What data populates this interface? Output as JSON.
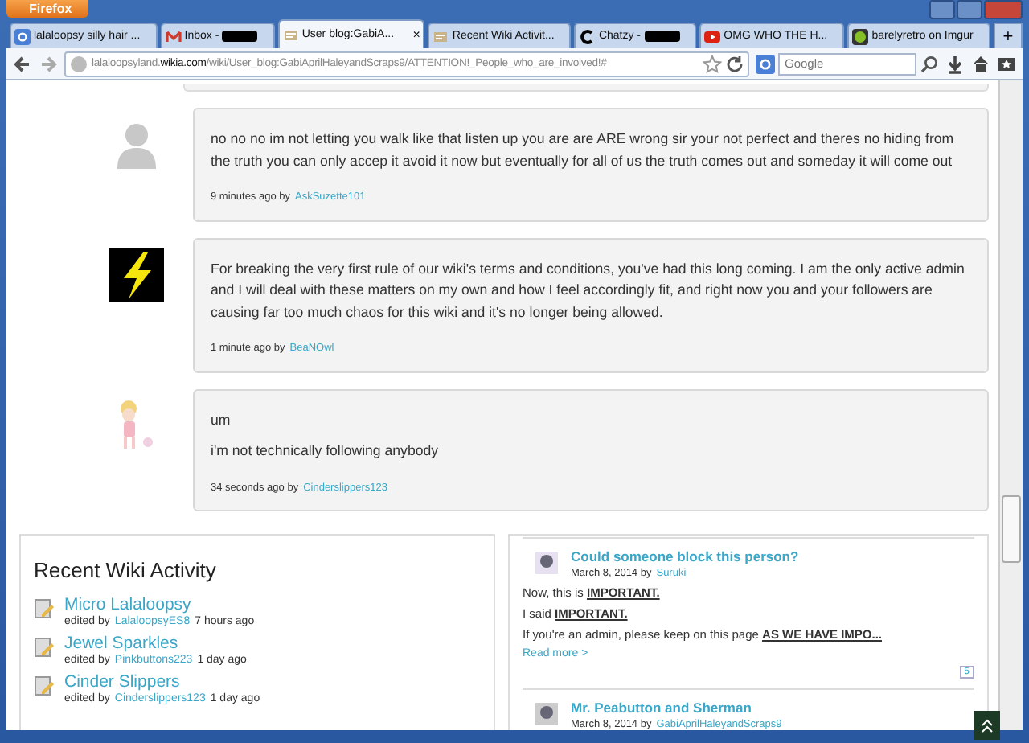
{
  "window": {
    "menu_button": "Firefox"
  },
  "tabs": [
    {
      "kind": "g",
      "label": "lalaloopsy silly hair ...",
      "selected": false
    },
    {
      "kind": "mail",
      "label": "Inbox -",
      "redacted": true,
      "selected": false
    },
    {
      "kind": "blog",
      "label": "User blog:GabiA...",
      "selected": true,
      "close": "×"
    },
    {
      "kind": "blog",
      "label": "Recent Wiki Activit...",
      "selected": false
    },
    {
      "kind": "chat",
      "label": "Chatzy -",
      "redacted": true,
      "selected": false
    },
    {
      "kind": "video",
      "label": "OMG WHO THE H...",
      "selected": false
    },
    {
      "kind": "dot",
      "label": "barelyretro on Imgur",
      "selected": false
    }
  ],
  "new_tab": "+",
  "address": {
    "url": "lalaloopsyland.**wikia.com**/wiki/User_blog:GabiAprilHaleyandScraps9/ATTENTION!_People_who_are_involved!#"
  },
  "search": {
    "placeholder": "Google"
  },
  "comments": [
    {
      "kind": "silhouette",
      "paragraphs": [
        "no no no im not letting you walk like that listen up you are are ARE wrong sir your not perfect and theres no hiding from the truth you can only accep it avoid it now but eventually for all of us the truth comes out and someday it will come out"
      ],
      "time": "9 minutes ago by",
      "author": "AskSuzette101"
    },
    {
      "kind": "bolt",
      "paragraphs": [
        "For breaking the very first rule of our wiki's terms and conditions, you've had this long coming. I am the only active admin and I will deal with these matters on my own and how I feel accordingly fit, and right now you and your followers are causing far too much chaos for this wiki and it's no longer being allowed."
      ],
      "time": "1 minute ago by",
      "author": "BeaNOwl"
    },
    {
      "kind": "doll",
      "paragraphs": [
        "um",
        "i'm not technically following anybody"
      ],
      "time": "34 seconds ago by",
      "author": "Cinderslippers123"
    }
  ],
  "activity": {
    "title": "Recent Wiki Activity",
    "items": [
      {
        "title": "Micro Lalaloopsy",
        "edited_by": "edited by",
        "user": "LalaloopsyES8",
        "time": "7 hours ago"
      },
      {
        "title": "Jewel Sparkles",
        "edited_by": "edited by",
        "user": "Pinkbuttons223",
        "time": "1 day ago"
      },
      {
        "title": "Cinder Slippers",
        "edited_by": "edited by",
        "user": "Cinderslippers123",
        "time": "1 day ago"
      }
    ]
  },
  "posts": [
    {
      "title": "Could someone block this person?",
      "date": "March 8, 2014 by",
      "author": "Suruki",
      "body": [
        "Now, this is **IMPORTANT.**",
        "I said **IMPORTANT.**",
        "If you're an admin, please keep on this page **AS WE HAVE IMPO...**"
      ],
      "read_more": "Read more >",
      "count": "5"
    },
    {
      "title": "Mr. Peabutton and Sherman",
      "date": "March 8, 2014 by",
      "author": "GabiAprilHaleyandScraps9"
    }
  ]
}
